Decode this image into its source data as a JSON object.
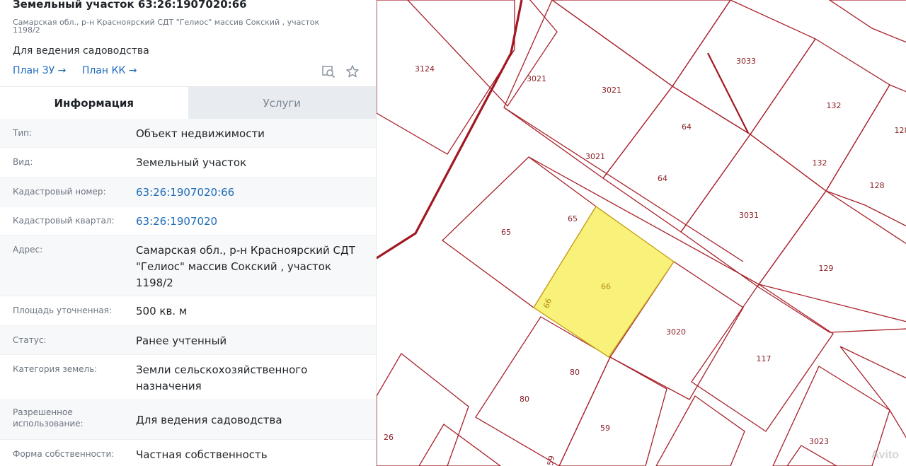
{
  "header": {
    "title": "Земельный участок 63:26:1907020:66",
    "address_small": "Самарская обл., р-н Красноярский СДТ \"Гелиос\" массив Сокский , участок 1198/2",
    "purpose": "Для ведения садоводства",
    "link_plan_zu": "План ЗУ →",
    "link_plan_kk": "План КК →"
  },
  "tabs": [
    {
      "label": "Информация",
      "active": true
    },
    {
      "label": "Услуги",
      "active": false
    }
  ],
  "info_rows": [
    {
      "label": "Тип:",
      "value": "Объект недвижимости"
    },
    {
      "label": "Вид:",
      "value": "Земельный участок"
    },
    {
      "label": "Кадастровый номер:",
      "value": "63:26:1907020:66"
    },
    {
      "label": "Кадастровый квартал:",
      "value": "63:26:1907020"
    },
    {
      "label": "Адрес:",
      "value": "Самарская обл., р-н Красноярский СДТ \"Гелиос\" массив Сокский , участок 1198/2"
    },
    {
      "label": "Площадь уточненная:",
      "value": "500 кв. м"
    },
    {
      "label": "Статус:",
      "value": "Ранее учтенный"
    },
    {
      "label": "Категория земель:",
      "value": "Земли сельскохозяйственного назначения"
    },
    {
      "label": "Разрешенное использование:",
      "value": "Для ведения садоводства"
    },
    {
      "label": "Форма собственности:",
      "value": "Частная собственность"
    }
  ],
  "map": {
    "labels": [
      "3124",
      "3021",
      "3021",
      "3021",
      "3033",
      "132",
      "132",
      "128",
      "128",
      "64",
      "64",
      "3031",
      "65",
      "65",
      "66",
      "66",
      "129",
      "3020",
      "117",
      "80",
      "80",
      "59",
      "59",
      "26",
      "3023"
    ],
    "highlight_color": "#f8f27a",
    "line_color": "#a8202a"
  },
  "watermark": "Avito",
  "icons": {
    "search": "search-map-icon",
    "star": "star-icon"
  }
}
